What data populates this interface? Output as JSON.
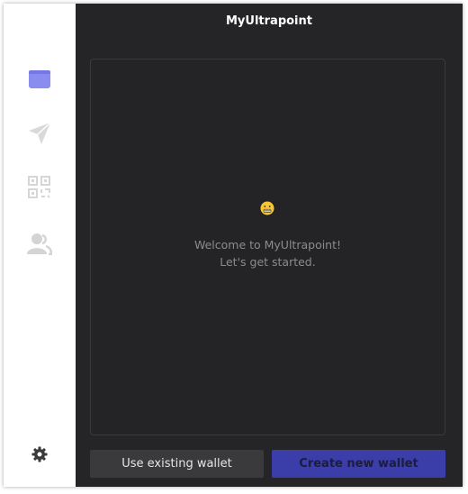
{
  "window": {
    "title": "MyUltrapoint"
  },
  "sidebar": {
    "items": [
      {
        "icon": "wallet-icon",
        "active": true
      },
      {
        "icon": "send-icon",
        "active": false
      },
      {
        "icon": "qr-code-icon",
        "active": false
      },
      {
        "icon": "contacts-icon",
        "active": false
      }
    ],
    "settings_icon": "gear-icon"
  },
  "welcome": {
    "emoji": "grimacing-face-emoji",
    "line1": "Welcome to MyUltrapoint!",
    "line2": "Let's get started."
  },
  "actions": {
    "existing_label": "Use existing wallet",
    "create_label": "Create new wallet"
  },
  "colors": {
    "accent": "#8a8cf0",
    "primary_button": "#3b3ea8",
    "background": "#252427"
  }
}
